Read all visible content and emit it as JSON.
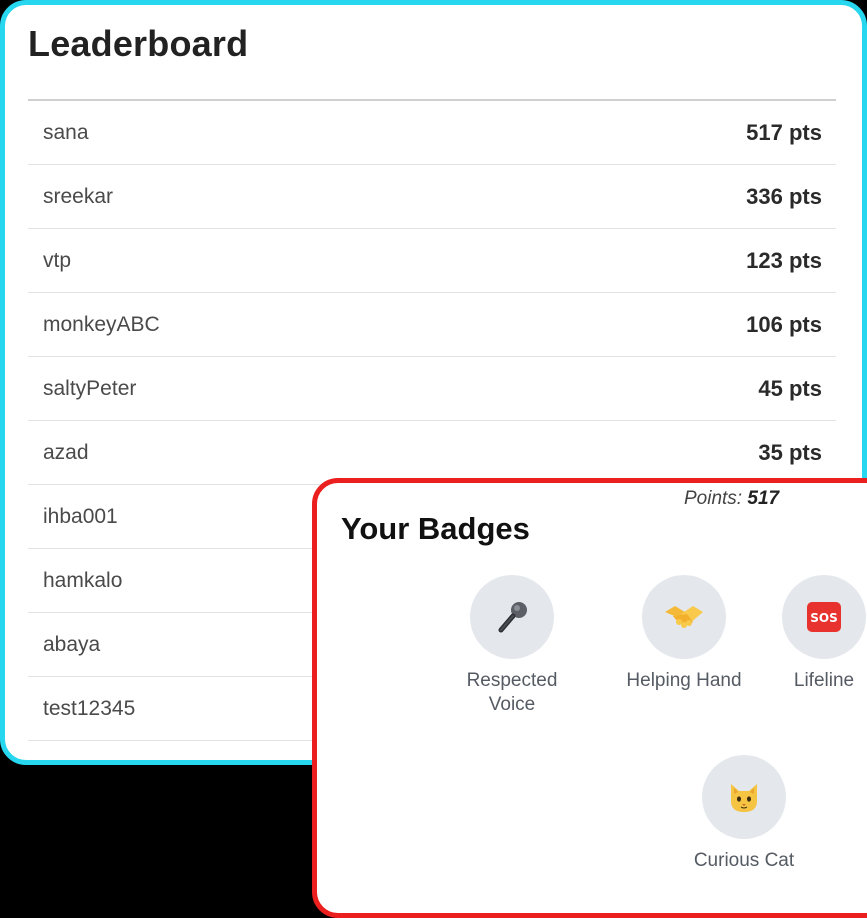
{
  "leaderboard": {
    "title": "Leaderboard",
    "rows": [
      {
        "name": "sana",
        "points": "517 pts"
      },
      {
        "name": "sreekar",
        "points": "336 pts"
      },
      {
        "name": "vtp",
        "points": "123 pts"
      },
      {
        "name": "monkeyABC",
        "points": "106 pts"
      },
      {
        "name": "saltyPeter",
        "points": "45 pts"
      },
      {
        "name": "azad",
        "points": "35 pts"
      },
      {
        "name": "ihba001",
        "points": ""
      },
      {
        "name": "hamkalo",
        "points": ""
      },
      {
        "name": "abaya",
        "points": ""
      },
      {
        "name": "test12345",
        "points": ""
      }
    ]
  },
  "badges": {
    "title": "Your Badges",
    "points_label": "Points:",
    "points_value": "517",
    "items": [
      {
        "label": "Respected Voice",
        "icon": "microphone-icon"
      },
      {
        "label": "Helping Hand",
        "icon": "handshake-icon"
      },
      {
        "label": "Lifeline",
        "icon": "sos-icon"
      },
      {
        "label": "Curious Cat",
        "icon": "cat-face-icon"
      }
    ]
  },
  "colors": {
    "leaderboard_border": "#27d6ef",
    "badges_border": "#ec1f1f",
    "badge_circle": "#e4e8ec",
    "background": "#000000"
  }
}
